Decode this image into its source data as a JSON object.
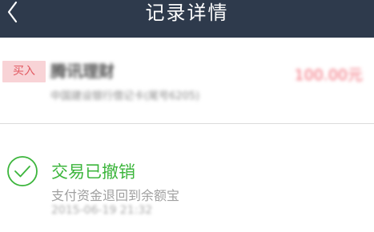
{
  "header": {
    "title": "记录详情",
    "back_icon": "chevron-left-icon",
    "background": "#2e3a4c"
  },
  "order": {
    "type_badge": "买入",
    "fund_name": "腾讯理财",
    "fund_detail": "中国建设银行借记卡(尾号6205)",
    "amount": "100.00元",
    "badge_color": "#e25a62",
    "amount_color": "#f26c78"
  },
  "status": {
    "icon": "check-circle-icon",
    "title": "交易已撤销",
    "description": "支付资金退回到余额宝",
    "time": "2015-06-19 21:32",
    "color": "#3bb53b"
  }
}
